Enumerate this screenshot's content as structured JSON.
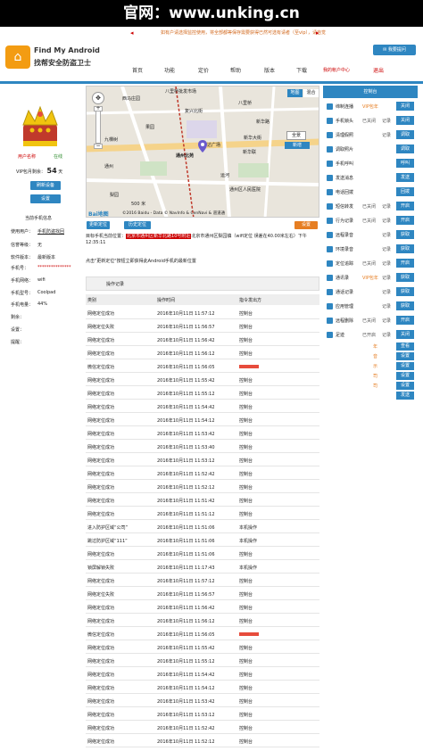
{
  "topbar": {
    "text": "官网：www.unking.cn"
  },
  "notice": {
    "text": "如有户请选择监控使用，将全部都等保存需要获得已然可选有请者（至vip），请自觉"
  },
  "logo": {
    "line1": "Find My Android",
    "line2": "找帮安全防盗卫士"
  },
  "cta": {
    "label": "我要提问"
  },
  "nav": [
    "首页",
    "功能",
    "定价",
    "帮助",
    "版本",
    "下载",
    "我的帐户中心",
    "退出"
  ],
  "user": {
    "name": "用户名称",
    "status": "在线",
    "vip_label": "VIP包月剩余：",
    "vip_days": "54",
    "vip_unit": "天",
    "btn_refresh": "刷新设备",
    "btn_settings": "设置"
  },
  "current_phone": {
    "title": "当前手机信息",
    "rows": [
      {
        "k": "使用用户：",
        "v": "手机防盗找回"
      },
      {
        "k": "信誉等级：",
        "v": "无"
      },
      {
        "k": "软件版本：",
        "v": "最新版本"
      },
      {
        "k": "手机号：",
        "v": "***************"
      },
      {
        "k": "手机网络：",
        "v": "wifi"
      },
      {
        "k": "手机型号：",
        "v": "Coolpad"
      },
      {
        "k": "手机电量：",
        "v": "44%"
      },
      {
        "k": "剩余：",
        "v": ""
      },
      {
        "k": "设置：",
        "v": ""
      },
      {
        "k": "提醒：",
        "v": ""
      }
    ]
  },
  "map": {
    "labels": [
      "西马庄园",
      "八里桥批发市场",
      "通州北苑",
      "万达广场",
      "新华联",
      "八里桥",
      "新华大街",
      "九棵树",
      "梨园",
      "通州",
      "新华路",
      "果园",
      "北京东",
      "临河里",
      "玉带河",
      "盛世家园",
      "运河",
      "通州区人民医院",
      "复兴北街",
      "通州北苑"
    ],
    "btn_map": "地图",
    "btn_mixed": "混合",
    "btn_new": "新增",
    "scale": "500 米",
    "copyright": "©2016 Baidu - Data © NavInfo & CenNavi & 道道通",
    "btn_full": "全景"
  },
  "loc_buttons": {
    "update": "更新定位",
    "history": "历史定位",
    "settings": "设置"
  },
  "location": {
    "prefix": "目标手机当前位置：",
    "text": "北京市通州区梨园镇（wifi定位 误差在40.00米左右）下午12:35:11",
    "redacted": "北京市通州区新华北路10号附近"
  },
  "hint": {
    "text": "点击\"更新定位\"按钮立即获得此Android手机的最新位置"
  },
  "record": {
    "label": "操作记录",
    "headers": [
      "类别",
      "操作时间",
      "指令发出方"
    ]
  },
  "records": [
    {
      "t": "网络定位成功",
      "time": "2016年10月11日 11:57:12",
      "src": "控制台"
    },
    {
      "t": "网络定位失败",
      "time": "2016年10月11日 11:56:57",
      "src": "控制台"
    },
    {
      "t": "网络定位成功",
      "time": "2016年10月11日 11:56:42",
      "src": "控制台"
    },
    {
      "t": "网络定位成功",
      "time": "2016年10月11日 11:56:12",
      "src": "控制台"
    },
    {
      "t": "微信定位成功",
      "time": "2016年10月11日 11:56:05",
      "src": ""
    },
    {
      "t": "网络定位成功",
      "time": "2016年10月11日 11:55:42",
      "src": "控制台"
    },
    {
      "t": "网络定位成功",
      "time": "2016年10月11日 11:55:12",
      "src": "控制台"
    },
    {
      "t": "网络定位成功",
      "time": "2016年10月11日 11:54:42",
      "src": "控制台"
    },
    {
      "t": "网络定位成功",
      "time": "2016年10月11日 11:54:12",
      "src": "控制台"
    },
    {
      "t": "网络定位成功",
      "time": "2016年10月11日 11:53:42",
      "src": "控制台"
    },
    {
      "t": "网络定位成功",
      "time": "2016年10月11日 11:53:40",
      "src": "控制台"
    },
    {
      "t": "网络定位成功",
      "time": "2016年10月11日 11:53:12",
      "src": "控制台"
    },
    {
      "t": "网络定位成功",
      "time": "2016年10月11日 11:52:42",
      "src": "控制台"
    },
    {
      "t": "网络定位成功",
      "time": "2016年10月11日 11:52:12",
      "src": "控制台"
    },
    {
      "t": "网络定位成功",
      "time": "2016年10月11日 11:51:42",
      "src": "控制台"
    },
    {
      "t": "网络定位成功",
      "time": "2016年10月11日 11:51:12",
      "src": "控制台"
    },
    {
      "t": "进入防护区域“公司”",
      "time": "2016年10月11日 11:51:06",
      "src": "本机操作"
    },
    {
      "t": "跳过防护区域“111”",
      "time": "2016年10月11日 11:51:06",
      "src": "本机操作"
    },
    {
      "t": "网络定位成功",
      "time": "2016年10月11日 11:51:06",
      "src": "控制台"
    },
    {
      "t": "锁屏解锁失败",
      "time": "2016年10月11日 11:17:43",
      "src": "本机操作"
    },
    {
      "t": "网络定位成功",
      "time": "2016年10月11日 11:57:12",
      "src": "控制台"
    },
    {
      "t": "网络定位失败",
      "time": "2016年10月11日 11:56:57",
      "src": "控制台"
    },
    {
      "t": "网络定位成功",
      "time": "2016年10月11日 11:56:42",
      "src": "控制台"
    },
    {
      "t": "网络定位成功",
      "time": "2016年10月11日 11:56:12",
      "src": "控制台"
    },
    {
      "t": "微信定位成功",
      "time": "2016年10月11日 11:56:05",
      "src": ""
    },
    {
      "t": "网络定位成功",
      "time": "2016年10月11日 11:55:42",
      "src": "控制台"
    },
    {
      "t": "网络定位成功",
      "time": "2016年10月11日 11:55:12",
      "src": "控制台"
    },
    {
      "t": "网络定位成功",
      "time": "2016年10月11日 11:54:42",
      "src": "控制台"
    },
    {
      "t": "网络定位成功",
      "time": "2016年10月11日 11:54:12",
      "src": "控制台"
    },
    {
      "t": "网络定位成功",
      "time": "2016年10月11日 11:53:42",
      "src": "控制台"
    },
    {
      "t": "网络定位成功",
      "time": "2016年10月11日 11:53:12",
      "src": "控制台"
    },
    {
      "t": "网络定位成功",
      "time": "2016年10月11日 11:52:42",
      "src": "控制台"
    },
    {
      "t": "网络定位成功",
      "time": "2016年10月11日 11:52:12",
      "src": "控制台"
    }
  ],
  "control": {
    "title": "控制台",
    "rows": [
      {
        "l": "缔制连播",
        "s": "VIP包年",
        "r": "",
        "b": "关闭"
      },
      {
        "l": "手机锁头",
        "s": "已关闭",
        "r": "记录",
        "b": "关闭"
      },
      {
        "l": "清理假照",
        "s": "",
        "r": "记录",
        "b": "调取"
      },
      {
        "l": "调取照片",
        "s": "",
        "r": "",
        "b": "调取"
      },
      {
        "l": "手机呼叫",
        "s": "",
        "r": "",
        "b": "呼叫"
      },
      {
        "l": "发送消息",
        "s": "",
        "r": "",
        "b": "发送"
      },
      {
        "l": "电话回拨",
        "s": "",
        "r": "",
        "b": "回拨"
      },
      {
        "l": "短信转发",
        "s": "已关闭",
        "r": "记录",
        "b": "开启"
      },
      {
        "l": "行为记录",
        "s": "已关闭",
        "r": "记录",
        "b": "开启"
      },
      {
        "l": "远程录音",
        "s": "",
        "r": "记录",
        "b": "获取"
      },
      {
        "l": "环境录音",
        "s": "",
        "r": "记录",
        "b": "获取"
      },
      {
        "l": "定位追踪",
        "s": "已关闭",
        "r": "记录",
        "b": "开启"
      },
      {
        "l": "通讯录",
        "s": "VIP包年",
        "r": "记录",
        "b": "获取"
      },
      {
        "l": "通话记录",
        "s": "",
        "r": "记录",
        "b": "获取"
      },
      {
        "l": "应用管理",
        "s": "",
        "r": "记录",
        "b": "获取"
      },
      {
        "l": "远程删除",
        "s": "已关闭",
        "r": "记录",
        "b": "开启"
      },
      {
        "l": "足迹",
        "s": "已开启",
        "r": "记录",
        "b": "关闭"
      }
    ],
    "extra": [
      {
        "s": "年",
        "b": "查看"
      },
      {
        "s": "音",
        "b": "设置"
      },
      {
        "s": "示",
        "b": "设置"
      },
      {
        "s": "司",
        "b": "设置"
      },
      {
        "s": "司",
        "b": "设置"
      },
      {
        "s": "",
        "b": "发送"
      }
    ]
  }
}
